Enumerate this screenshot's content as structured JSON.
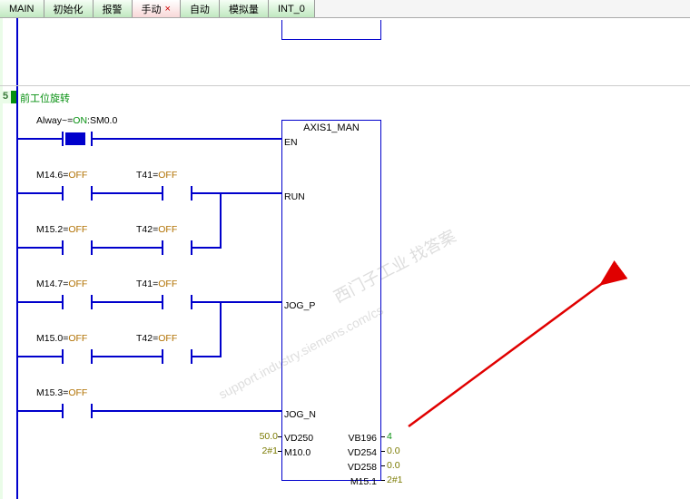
{
  "tabs": {
    "t0": "MAIN",
    "t1": "初始化",
    "t2": "报警",
    "t3": "手动",
    "t3x": "×",
    "t4": "自动",
    "t5": "模拟量",
    "t6": "INT_0"
  },
  "network": {
    "num": "5",
    "title": "前工位旋转"
  },
  "rung0": {
    "c1_addr": "Alway~",
    "c1_eq": "=",
    "c1_state": "ON",
    "c1_suffix": ":SM0.0"
  },
  "rung1": {
    "c1_addr": "M14.6",
    "c1_eq": "=",
    "c1_state": "OFF",
    "c2_addr": "T41",
    "c2_eq": "=",
    "c2_state": "OFF"
  },
  "rung2": {
    "c1_addr": "M15.2",
    "c1_eq": "=",
    "c1_state": "OFF",
    "c2_addr": "T42",
    "c2_eq": "=",
    "c2_state": "OFF"
  },
  "rung3": {
    "c1_addr": "M14.7",
    "c1_eq": "=",
    "c1_state": "OFF",
    "c2_addr": "T41",
    "c2_eq": "=",
    "c2_state": "OFF"
  },
  "rung4": {
    "c1_addr": "M15.0",
    "c1_eq": "=",
    "c1_state": "OFF",
    "c2_addr": "T42",
    "c2_eq": "=",
    "c2_state": "OFF"
  },
  "rung5": {
    "c1_addr": "M15.3",
    "c1_eq": "=",
    "c1_state": "OFF"
  },
  "block": {
    "title": "AXIS1_MAN",
    "pin_en": "EN",
    "pin_run": "RUN",
    "pin_jogp": "JOG_P",
    "pin_jogn": "JOG_N",
    "in1_val": "50.0",
    "in1_pin": "VD250",
    "in2_val": "2#1",
    "in2_pin": "M10.0",
    "out1_pin": "VB196",
    "out1_val": "4",
    "out2_pin": "VD254",
    "out2_val": "0.0",
    "out3_pin": "VD258",
    "out3_val": "0.0",
    "out4_pin": "M15.1",
    "out4_val": "2#1"
  },
  "watermark": {
    "a": "西门子工业 找答案",
    "b": "support.industry.siemens.com/cs"
  }
}
